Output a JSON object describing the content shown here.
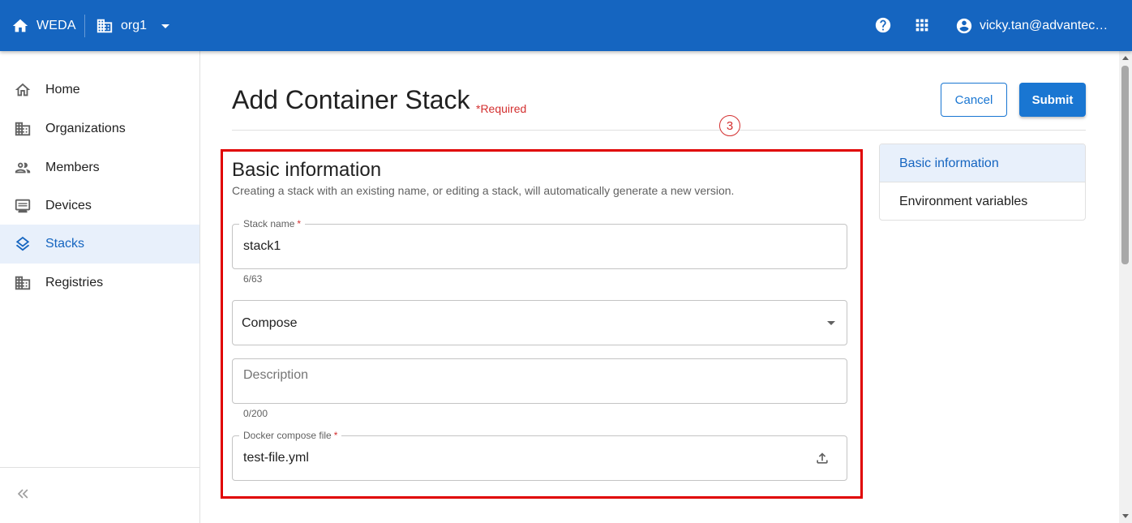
{
  "topbar": {
    "app_name": "WEDA",
    "org_name": "org1",
    "user_email": "vicky.tan@advantech.com",
    "icons": [
      "home-icon",
      "building-icon",
      "chevron-down-icon",
      "help-icon",
      "apps-grid-icon",
      "account-circle-icon"
    ]
  },
  "sidebar": {
    "items": [
      {
        "label": "Home",
        "icon": "home-outline-icon",
        "active": false
      },
      {
        "label": "Organizations",
        "icon": "building-icon",
        "active": false
      },
      {
        "label": "Members",
        "icon": "people-icon",
        "active": false
      },
      {
        "label": "Devices",
        "icon": "device-icon",
        "active": false
      },
      {
        "label": "Stacks",
        "icon": "layers-icon",
        "active": true
      },
      {
        "label": "Registries",
        "icon": "building-icon",
        "active": false
      }
    ],
    "collapse_icon": "double-chevron-left-icon"
  },
  "page": {
    "title": "Add Container Stack",
    "required_note": "*Required",
    "cancel_label": "Cancel",
    "submit_label": "Submit",
    "step_badge": "3"
  },
  "basic_info": {
    "title": "Basic information",
    "description": "Creating a stack with an existing name, or editing a stack, will automatically generate a new version.",
    "stack_name": {
      "label": "Stack name",
      "required_mark": "*",
      "value": "stack1",
      "counter": "6/63"
    },
    "type_select": {
      "value": "Compose"
    },
    "description_field": {
      "placeholder": "Description",
      "value": "",
      "counter": "0/200"
    },
    "compose_file": {
      "label": "Docker compose file",
      "required_mark": "*",
      "value": "test-file.yml",
      "icon": "upload-icon"
    }
  },
  "section_nav": {
    "items": [
      {
        "label": "Basic information",
        "active": true
      },
      {
        "label": "Environment variables",
        "active": false
      }
    ]
  },
  "colors": {
    "primary": "#1565c0",
    "button": "#1976d2",
    "active_bg": "#e8f0fb",
    "required": "#d32f2f",
    "highlight": "#e00000"
  }
}
